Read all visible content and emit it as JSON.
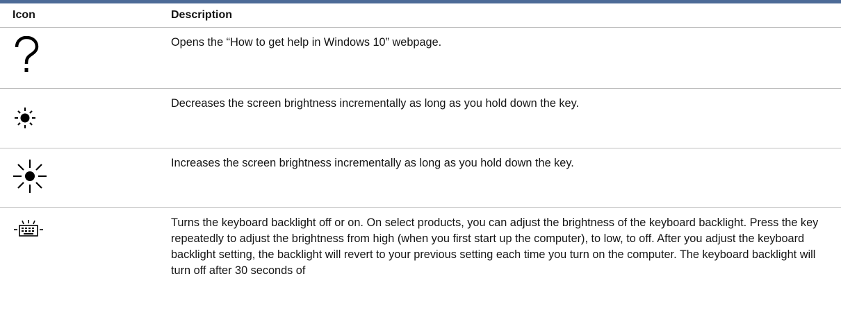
{
  "table": {
    "header": {
      "icon": "Icon",
      "description": "Description"
    },
    "rows": [
      {
        "icon": "question-mark-icon",
        "description": "Opens the “How to get help in Windows 10” webpage."
      },
      {
        "icon": "brightness-down-icon",
        "description": "Decreases the screen brightness incrementally as long as you hold down the key."
      },
      {
        "icon": "brightness-up-icon",
        "description": "Increases the screen brightness incrementally as long as you hold down the key."
      },
      {
        "icon": "keyboard-backlight-icon",
        "description": "Turns the keyboard backlight off or on. On select products, you can adjust the brightness of the keyboard backlight. Press the key repeatedly to adjust the brightness from high (when you first start up the computer), to low, to off. After you adjust the keyboard backlight setting, the backlight will revert to your previous setting each time you turn on the computer. The keyboard backlight will turn off after 30 seconds of"
      }
    ]
  },
  "colors": {
    "header_rule": "#4d6b97",
    "row_border": "#bdbdbd"
  }
}
